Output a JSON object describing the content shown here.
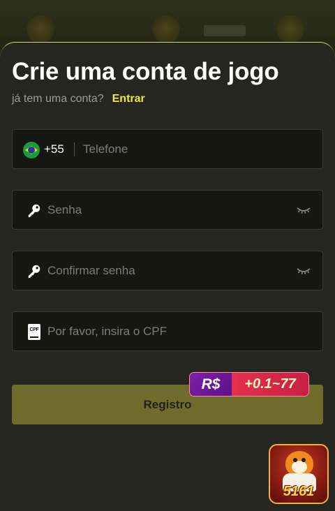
{
  "header": {
    "title": "Crie uma conta de jogo",
    "subtitle_question": "já tem uma conta?",
    "login_link": "Entrar"
  },
  "form": {
    "phone": {
      "country_code": "+55",
      "placeholder": "Telefone",
      "flag": "brazil-flag-icon"
    },
    "password": {
      "placeholder": "Senha",
      "left_icon": "key-icon",
      "right_icon": "eye-closed-icon"
    },
    "confirm_password": {
      "placeholder": "Confirmar senha",
      "left_icon": "key-icon",
      "right_icon": "eye-closed-icon"
    },
    "cpf": {
      "placeholder": "Por favor, insira o CPF",
      "icon_text": "CPF"
    }
  },
  "register_button": {
    "label": "Registro"
  },
  "bonus_badge": {
    "currency": "R$",
    "amount": "+0.1~77"
  },
  "app_icon": {
    "label": "5161"
  },
  "colors": {
    "accent": "#f1e93c",
    "sheet_bg": "#262621",
    "field_bg": "#161613",
    "button_bg": "#6e6b2c",
    "badge_purple": "#7f1ea8",
    "badge_red": "#e5304f"
  }
}
